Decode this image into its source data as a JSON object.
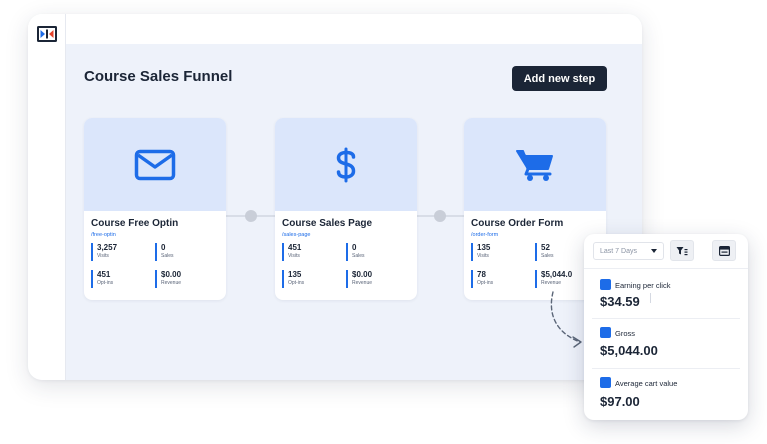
{
  "page": {
    "title": "Course Sales Funnel",
    "add_step_label": "Add new step"
  },
  "steps": [
    {
      "title": "Course Free Optin",
      "path": "/free-optin",
      "icon": "envelope-icon",
      "stats": [
        {
          "value": "3,257",
          "label": "Visits"
        },
        {
          "value": "0",
          "label": "Sales"
        },
        {
          "value": "451",
          "label": "Opt-ins"
        },
        {
          "value": "$0.00",
          "label": "Revenue"
        }
      ]
    },
    {
      "title": "Course Sales Page",
      "path": "/sales-page",
      "icon": "dollar-sign-icon",
      "stats": [
        {
          "value": "451",
          "label": "Visits"
        },
        {
          "value": "0",
          "label": "Sales"
        },
        {
          "value": "135",
          "label": "Opt-ins"
        },
        {
          "value": "$0.00",
          "label": "Revenue"
        }
      ]
    },
    {
      "title": "Course Order Form",
      "path": "/order-form",
      "icon": "shopping-cart-icon",
      "stats": [
        {
          "value": "135",
          "label": "Visits"
        },
        {
          "value": "52",
          "label": "Sales"
        },
        {
          "value": "78",
          "label": "Opt-ins"
        },
        {
          "value": "$5,044.0",
          "label": "Revenue"
        }
      ]
    }
  ],
  "stats_panel": {
    "date_range": "Last 7 Days",
    "metrics": [
      {
        "label": "Earning per click",
        "value": "$34.59"
      },
      {
        "label": "Gross",
        "value": "$5,044.00"
      },
      {
        "label": "Average cart value",
        "value": "$97.00"
      }
    ]
  },
  "colors": {
    "accent": "#1d6ce8",
    "dark": "#1b2536",
    "card_hero": "#dbe6fb",
    "canvas": "#eef2fa"
  }
}
